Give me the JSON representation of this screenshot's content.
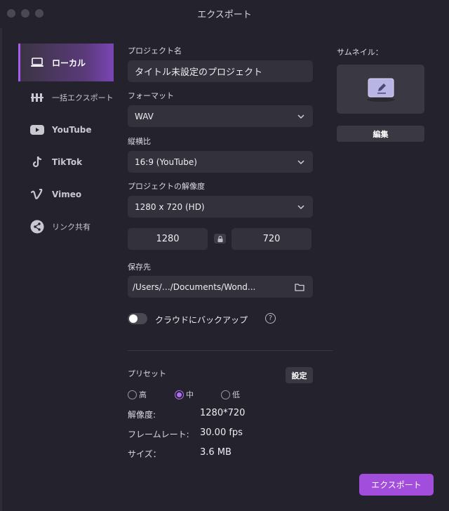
{
  "window": {
    "title": "エクスポート"
  },
  "sidebar": {
    "items": [
      {
        "label": "ローカル",
        "icon": "laptop-icon",
        "active": true
      },
      {
        "label": "一括エクスポート",
        "icon": "batch-icon",
        "active": false
      },
      {
        "label": "YouTube",
        "icon": "youtube-icon",
        "active": false
      },
      {
        "label": "TikTok",
        "icon": "tiktok-icon",
        "active": false
      },
      {
        "label": "Vimeo",
        "icon": "vimeo-icon",
        "active": false
      },
      {
        "label": "リンク共有",
        "icon": "share-icon",
        "active": false
      }
    ]
  },
  "form": {
    "project_name_label": "プロジェクト名",
    "project_name_value": "タイトル未設定のプロジェクト",
    "format_label": "フォーマット",
    "format_value": "WAV",
    "aspect_label": "縦横比",
    "aspect_value": "16:9 (YouTube)",
    "resolution_label": "プロジェクトの解像度",
    "resolution_value": "1280 x 720 (HD)",
    "width_value": "1280",
    "height_value": "720",
    "save_label": "保存先",
    "save_path_value": "/Users/…/Documents/Wond...",
    "cloud_label": "クラウドにバックアップ",
    "cloud_help": "?"
  },
  "preset": {
    "label": "プリセット",
    "settings_button": "設定",
    "options": [
      {
        "label": "高",
        "selected": false
      },
      {
        "label": "中",
        "selected": true
      },
      {
        "label": "低",
        "selected": false
      }
    ],
    "rows": [
      {
        "key": "解像度:",
        "value": "1280*720"
      },
      {
        "key": "フレームレート:",
        "value": "30.00 fps"
      },
      {
        "key": "サイズ：",
        "value": "3.6 MB"
      }
    ]
  },
  "thumbnail": {
    "label": "サムネイル：",
    "edit_button": "編集"
  },
  "actions": {
    "export_button": "エクスポート"
  },
  "colors": {
    "accent": "#a34ddc",
    "radio_selected": "#b46ef5",
    "background": "#24222c"
  }
}
